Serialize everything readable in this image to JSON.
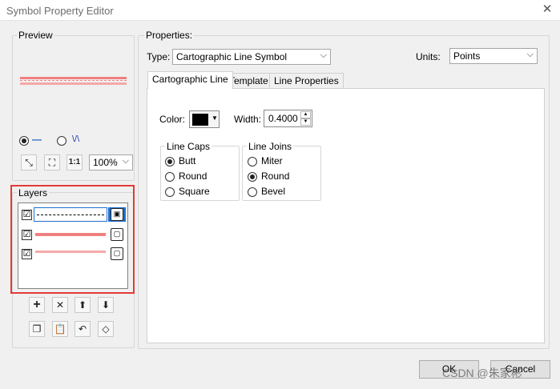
{
  "window": {
    "title": "Symbol Property Editor",
    "close_glyph": "✕"
  },
  "preview": {
    "label": "Preview",
    "line_mode_glyph": "—",
    "wave_mode_glyph": "\\/\\",
    "zoom_value": "100%",
    "line_color": "#f08080"
  },
  "layers": {
    "label": "Layers",
    "rows": [
      {
        "checked": "☑",
        "kind": "dash-dot",
        "selected": true
      },
      {
        "checked": "☑",
        "kind": "solid-thick",
        "color": "#f08080"
      },
      {
        "checked": "☑",
        "kind": "solid",
        "color": "#f5a9a9"
      }
    ],
    "highlight_color": "#e53935"
  },
  "properties": {
    "label": "Properties:",
    "type_label": "Type:",
    "type_value": "Cartographic Line Symbol",
    "units_label": "Units:",
    "units_value": "Points",
    "tabs": [
      "Cartographic Line",
      "Template",
      "Line Properties"
    ],
    "color_label": "Color:",
    "width_label": "Width:",
    "width_value": "0.4000",
    "line_caps": {
      "label": "Line Caps",
      "options": [
        "Butt",
        "Round",
        "Square"
      ],
      "selected": "Butt"
    },
    "line_joins": {
      "label": "Line Joins",
      "options": [
        "Miter",
        "Round",
        "Bevel"
      ],
      "selected": "Round"
    }
  },
  "footer": {
    "ok_label": "OK",
    "cancel_label": "Cancel"
  },
  "watermark": "CSDN @朱家彬"
}
